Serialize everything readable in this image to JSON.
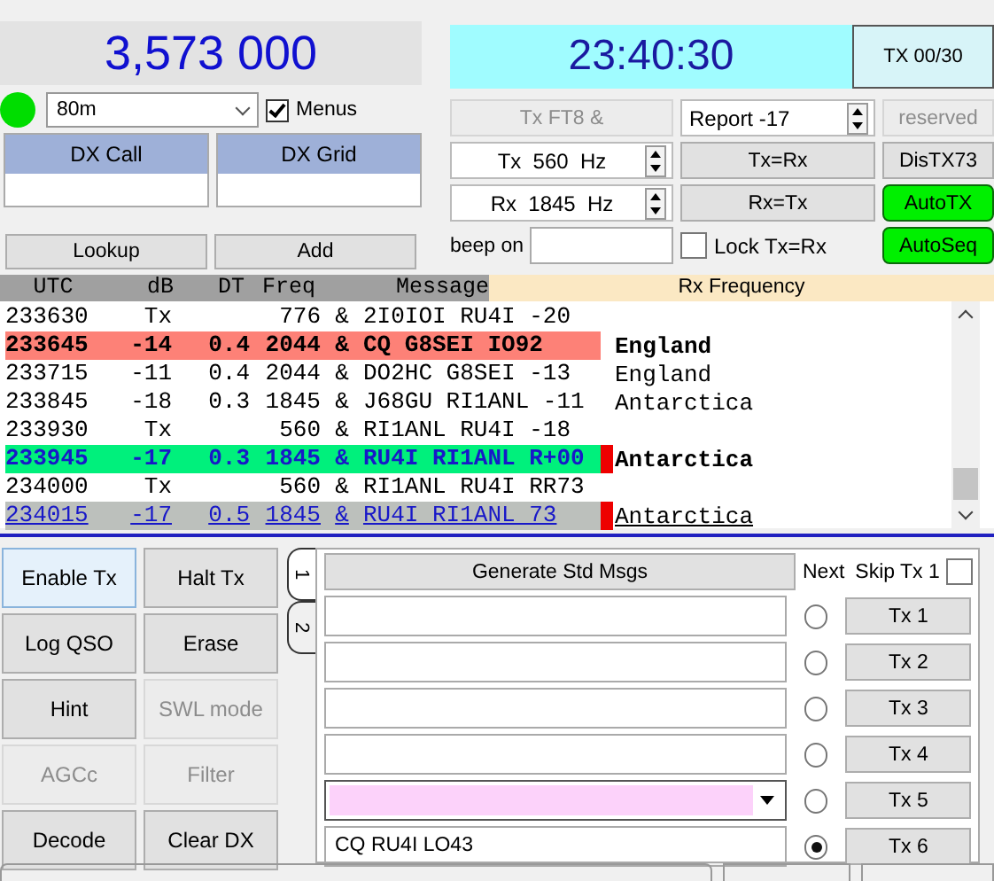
{
  "frequency": "3,573 000",
  "clock": "23:40:30",
  "tx_period": "TX 00/30",
  "status_ok": true,
  "band": {
    "value": "80m"
  },
  "menus": {
    "label": "Menus",
    "checked": true
  },
  "dx_fields": [
    {
      "label": "DX Call"
    },
    {
      "label": "DX Grid"
    }
  ],
  "dx_buttons": [
    {
      "label": "Lookup"
    },
    {
      "label": "Add"
    }
  ],
  "controls": [
    {
      "kind": "button",
      "label": "Tx FT8 &",
      "disabled": true
    },
    {
      "kind": "spin",
      "value": "Report -17"
    },
    {
      "kind": "button",
      "label": "reserved",
      "disabled": true
    },
    {
      "kind": "freq_spin",
      "value": "Tx  560  Hz"
    },
    {
      "kind": "button",
      "label": "Tx=Rx",
      "disabled": false
    },
    {
      "kind": "button",
      "label": "DisTX73",
      "disabled": false
    },
    {
      "kind": "freq_spin",
      "value": "Rx  1845  Hz"
    },
    {
      "kind": "button",
      "label": "Rx=Tx",
      "disabled": false
    },
    {
      "kind": "toggle",
      "label": "AutoTX",
      "on": true
    },
    {
      "kind": "beep",
      "label": "beep on"
    },
    {
      "kind": "check",
      "label": "Lock Tx=Rx",
      "checked": false
    },
    {
      "kind": "toggle",
      "label": "AutoSeq",
      "on": true
    }
  ],
  "decode": {
    "columns": [
      "UTC",
      "dB",
      "DT",
      "Freq",
      "Message"
    ],
    "rx_header": "Rx Frequency",
    "rows": [
      {
        "kind": "plain",
        "utc": "233630",
        "db": "Tx",
        "freq": "776",
        "mode": "&",
        "message": "2I0IOI RU4I -20",
        "marker": false
      },
      {
        "kind": "cq",
        "utc": "233645",
        "db": "-14",
        "dt": "0.4",
        "freq": "2044",
        "mode": "&",
        "message": "CQ G8SEI IO92",
        "country": "England",
        "marker": false
      },
      {
        "kind": "plain",
        "utc": "233715",
        "db": "-11",
        "dt": "0.4",
        "freq": "2044",
        "mode": "&",
        "message": "DO2HC G8SEI -13",
        "country": "England",
        "marker": false
      },
      {
        "kind": "plain",
        "utc": "233845",
        "db": "-18",
        "dt": "0.3",
        "freq": "1845",
        "mode": "&",
        "message": "J68GU RI1ANL -11",
        "country": "Antarctica",
        "marker": false
      },
      {
        "kind": "plain",
        "utc": "233930",
        "db": "Tx",
        "freq": "560",
        "mode": "&",
        "message": "RI1ANL RU4I -18",
        "marker": false
      },
      {
        "kind": "to_me",
        "utc": "233945",
        "db": "-17",
        "dt": "0.3",
        "freq": "1845",
        "mode": "&",
        "message": "RU4I RI1ANL R+00",
        "country": "Antarctica",
        "marker": true
      },
      {
        "kind": "plain",
        "utc": "234000",
        "db": "Tx",
        "freq": "560",
        "mode": "&",
        "message": "RI1ANL RU4I RR73",
        "marker": false
      },
      {
        "kind": "selected",
        "utc": "234015",
        "db": "-17",
        "dt": "0.5",
        "freq": "1845",
        "mode": "&",
        "message": "RU4I RI1ANL 73",
        "country": "Antarctica",
        "marker": true
      }
    ]
  },
  "action_buttons": [
    {
      "label": "Enable Tx",
      "disabled": false,
      "highlighted": true
    },
    {
      "label": "Halt Tx",
      "disabled": false,
      "highlighted": false
    },
    {
      "label": "Log QSO",
      "disabled": false,
      "highlighted": false
    },
    {
      "label": "Erase",
      "disabled": false,
      "highlighted": false
    },
    {
      "label": "Hint",
      "disabled": false,
      "highlighted": false
    },
    {
      "label": "SWL mode",
      "disabled": true,
      "highlighted": false
    },
    {
      "label": "AGCc",
      "disabled": true,
      "highlighted": false
    },
    {
      "label": "Filter",
      "disabled": true,
      "highlighted": false
    },
    {
      "label": "Decode",
      "disabled": false,
      "highlighted": false
    },
    {
      "label": "Clear DX",
      "disabled": false,
      "highlighted": false
    }
  ],
  "msg_tabs": [
    {
      "label": "1",
      "selected": true
    },
    {
      "label": "2",
      "selected": false
    }
  ],
  "generate": "Generate Std Msgs",
  "next_label": "Next",
  "skip_tx1": {
    "label": "Skip Tx 1",
    "checked": false
  },
  "messages": [
    {
      "kind": "text",
      "button": "Tx 1",
      "selected": false
    },
    {
      "kind": "text",
      "button": "Tx 2",
      "selected": false
    },
    {
      "kind": "text",
      "button": "Tx 3",
      "selected": false
    },
    {
      "kind": "text",
      "button": "Tx 4",
      "selected": false
    },
    {
      "kind": "combo",
      "button": "Tx 5",
      "selected": false
    },
    {
      "kind": "text",
      "value": "CQ RU4I LO43",
      "button": "Tx 6",
      "selected": true
    }
  ]
}
